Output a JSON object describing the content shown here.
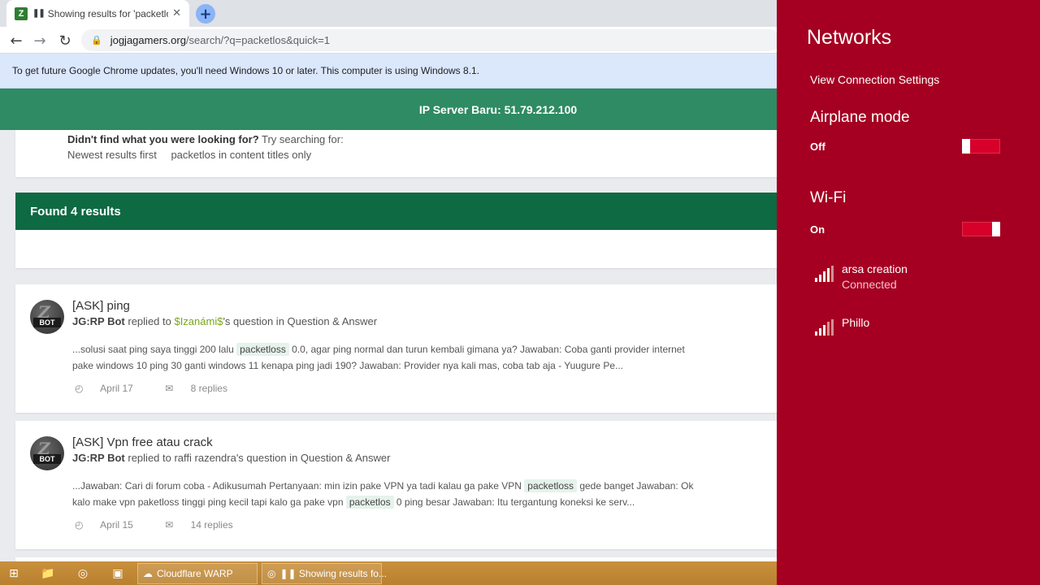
{
  "browser": {
    "tab": {
      "favicon": "Z",
      "state_icon": "❚❚",
      "title": "Showing results for 'packetlos'",
      "close_icon": "✕"
    },
    "new_tab_icon": "+",
    "back_icon": "←",
    "forward_icon": "→",
    "reload_icon": "↻",
    "lock_icon": "🔒",
    "url_host": "jogjagamers.org",
    "url_path": "/search/?q=packetlos&quick=1",
    "infobar_text": "To get future Google Chrome updates, you'll need Windows 10 or later. This computer is using Windows 8.1."
  },
  "page": {
    "banner_text": "IP Server Baru: 51.79.212.100",
    "suggestion": {
      "lead": "Didn't find what you were looking for?",
      "lead_rest": " Try searching for:",
      "link1": "Newest results first",
      "link2": "packetlos in content titles only"
    },
    "found_text": "Found 4 results",
    "results": [
      {
        "title": "[ASK] ping",
        "author": "JG:RP Bot",
        "replied_to": " replied to ",
        "quoted_user": "$Izanámi$",
        "question_suffix": "'s question in Question & Answer",
        "snippet_a": "...solusi saat ping saya tinggi 200 lalu ",
        "hl1": "packetloss",
        "snippet_b": " 0.0, agar ping normal dan turun kembali gimana ya? Jawaban: Coba ganti provider internet",
        "snippet_line2": "pake windows 10 ping 30 ganti windows 11 kenapa ping jadi 190? Jawaban: Provider nya kali mas, coba tab aja - Yuugure Pe...",
        "date": "April 17",
        "replies": "8 replies"
      },
      {
        "title": "[ASK] Vpn free atau crack",
        "author": "JG:RP Bot",
        "replied_to": " replied to ",
        "quoted_user": "raffi razendra",
        "question_suffix": "'s question in Question & Answer",
        "snippet_a": "...Jawaban: Cari di forum coba - Adikusumah Pertanyaan: min izin pake VPN ya tadi kalau ga pake VPN ",
        "hl1": "packetloss",
        "snippet_b": " gede banget Jawaban: Ok",
        "snippet_line2_a": "kalo make vpn paketloss tinggi ping kecil tapi kalo ga pake vpn ",
        "hl2": "packetlos",
        "snippet_line2_b": " 0 ping besar Jawaban: Itu tergantung koneksi ke serv...",
        "date": "April 15",
        "replies": "14 replies"
      }
    ],
    "avatar_badge": "BOT",
    "avatar_letter": "Z",
    "clock_icon": "◴",
    "comment_icon": "✉"
  },
  "taskbar": {
    "start_icon": "⊞",
    "explorer_icon": "📁",
    "chrome_icon": "◎",
    "app_icon": "▣",
    "task1_icon": "☁",
    "task1_label": "Cloudflare WARP",
    "task2_icon": "◎",
    "task2_label": "❚❚ Showing results fo..."
  },
  "networks": {
    "title": "Networks",
    "view_settings": "View Connection Settings",
    "airplane": {
      "label": "Airplane mode",
      "state": "Off",
      "value": false
    },
    "wifi": {
      "label": "Wi-Fi",
      "state": "On",
      "value": true
    },
    "list": [
      {
        "name": "arsa creation",
        "status": "Connected"
      },
      {
        "name": "Phillo",
        "status": ""
      }
    ]
  }
}
